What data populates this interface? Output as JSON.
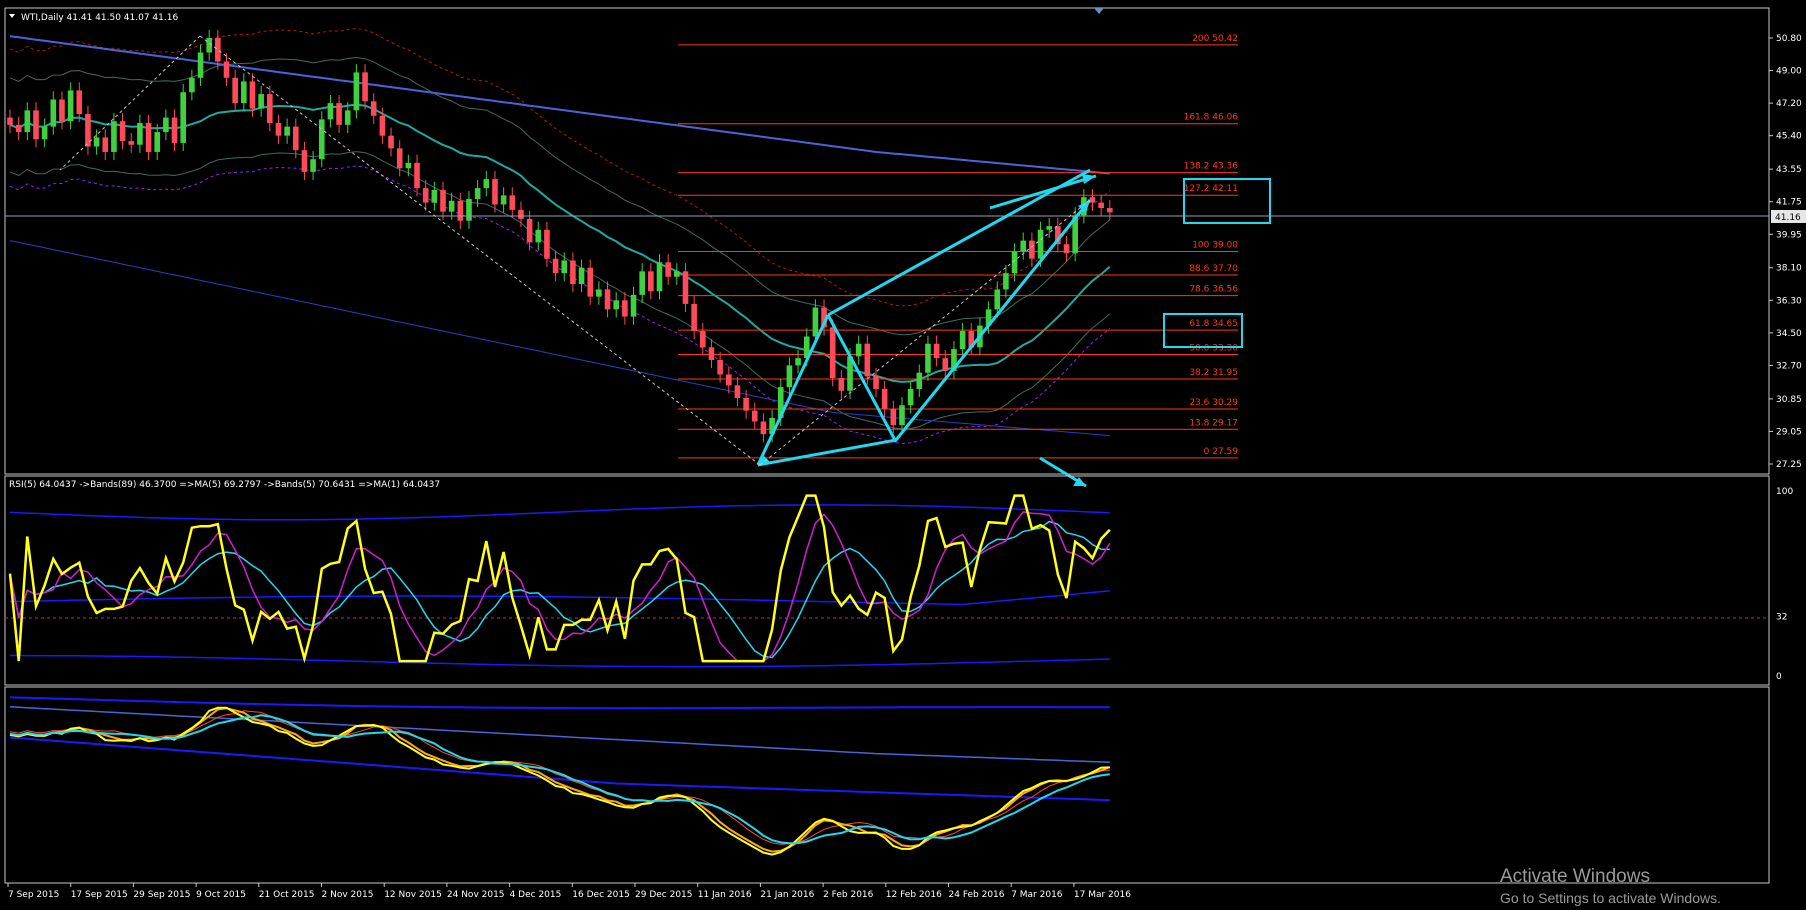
{
  "header": {
    "symbol_label": "WTI,Daily  41.41 41.50 41.07 41.16"
  },
  "rsi_label": "RSI(5) 64.0437  ->Bands(89) 46.3700  =>MA(5) 69.2797  ->Bands(5) 70.6431  =>MA(1) 64.0437",
  "watermark": {
    "title": "Activate Windows",
    "subtitle": "Go to Settings to activate Windows."
  },
  "colors": {
    "background": "#000000",
    "bull": "#3fd13f",
    "bear": "#ff4a5a",
    "fib": "#ff3a12",
    "cyan": "#21d8f0",
    "rsi": "#ffff1a",
    "blue_band": "#1a1aff",
    "grid": "#c8c8c8"
  },
  "chart_data": [
    {
      "type": "candlestick",
      "title": "WTI,Daily",
      "last_price": "41.16",
      "ylim": [
        27.25,
        50.8
      ],
      "y_ticks": [
        "50.80",
        "49.00",
        "47.20",
        "45.40",
        "43.55",
        "41.75",
        "39.95",
        "38.10",
        "36.30",
        "34.50",
        "32.70",
        "30.85",
        "29.05",
        "27.25"
      ],
      "x_ticks": [
        "7 Sep 2015",
        "17 Sep 2015",
        "29 Sep 2015",
        "9 Oct 2015",
        "21 Oct 2015",
        "2 Nov 2015",
        "12 Nov 2015",
        "24 Nov 2015",
        "4 Dec 2015",
        "16 Dec 2015",
        "29 Dec 2015",
        "11 Jan 2016",
        "21 Jan 2016",
        "2 Feb 2016",
        "12 Feb 2016",
        "24 Feb 2016",
        "7 Mar 2016",
        "17 Mar 2016"
      ],
      "closes": [
        46.0,
        45.6,
        46.8,
        45.2,
        45.9,
        47.4,
        46.2,
        47.9,
        46.6,
        44.8,
        45.3,
        44.5,
        46.2,
        45.1,
        44.9,
        46.1,
        44.5,
        45.6,
        46.4,
        45.0,
        47.8,
        48.6,
        50.0,
        50.8,
        49.5,
        48.6,
        47.2,
        48.4,
        46.9,
        47.7,
        46.1,
        45.4,
        45.9,
        44.6,
        43.4,
        44.1,
        46.3,
        47.2,
        46.0,
        46.8,
        48.9,
        47.3,
        46.5,
        45.4,
        44.7,
        43.6,
        43.9,
        42.5,
        41.7,
        42.4,
        41.2,
        41.8,
        40.7,
        41.9,
        42.5,
        43.0,
        41.6,
        42.1,
        41.3,
        40.8,
        39.5,
        40.2,
        38.6,
        37.8,
        38.5,
        37.2,
        38.1,
        36.5,
        36.9,
        35.8,
        36.3,
        35.4,
        36.6,
        37.9,
        36.8,
        38.4,
        37.6,
        37.9,
        36.1,
        34.6,
        33.7,
        33.0,
        32.2,
        31.6,
        30.9,
        30.2,
        29.6,
        28.9,
        29.8,
        31.5,
        32.7,
        33.1,
        34.3,
        35.9,
        34.8,
        32.0,
        31.3,
        33.2,
        33.9,
        32.1,
        31.4,
        30.3,
        29.4,
        30.5,
        31.4,
        32.3,
        33.9,
        33.1,
        32.4,
        33.6,
        34.6,
        33.7,
        34.9,
        35.8,
        36.9,
        37.8,
        39.0,
        39.6,
        38.6,
        40.2,
        40.4,
        39.4,
        38.9,
        41.0,
        42.0,
        41.7,
        41.4,
        41.16
      ],
      "candle_count": 130,
      "fibonacci_levels": [
        {
          "label": "200 50.42",
          "value": 50.42
        },
        {
          "label": "161.8 46.06",
          "value": 46.06
        },
        {
          "label": "138.2 43.36",
          "value": 43.36
        },
        {
          "label": "127.2 42.11",
          "value": 42.11
        },
        {
          "label": "100 39.00",
          "value": 39.0
        },
        {
          "label": "88.6 37.70",
          "value": 37.7
        },
        {
          "label": "78.6 36.56",
          "value": 36.56
        },
        {
          "label": "61.8 34.65",
          "value": 34.65
        },
        {
          "label": "50.0 33.30",
          "value": 33.3
        },
        {
          "label": "38.2 31.95",
          "value": 31.95
        },
        {
          "label": "23.6 30.29",
          "value": 30.29
        },
        {
          "label": "13.8 29.17",
          "value": 29.17
        },
        {
          "label": "0 27.59",
          "value": 27.59
        }
      ],
      "highlighted_levels": [
        "127.2 42.11",
        "61.8 34.65"
      ]
    },
    {
      "type": "line",
      "title": "RSI(5)",
      "ylim": [
        0,
        100
      ],
      "y_ticks": [
        "100",
        "32",
        "0"
      ],
      "reference_level": 32,
      "series": [
        {
          "name": "RSI(5)",
          "last": 64.0437
        },
        {
          "name": "Bands(89)",
          "last": 46.37
        },
        {
          "name": "MA(5)",
          "last": 69.2797
        },
        {
          "name": "Bands(5)",
          "last": 70.6431
        },
        {
          "name": "MA(1)",
          "last": 64.0437
        }
      ]
    }
  ]
}
